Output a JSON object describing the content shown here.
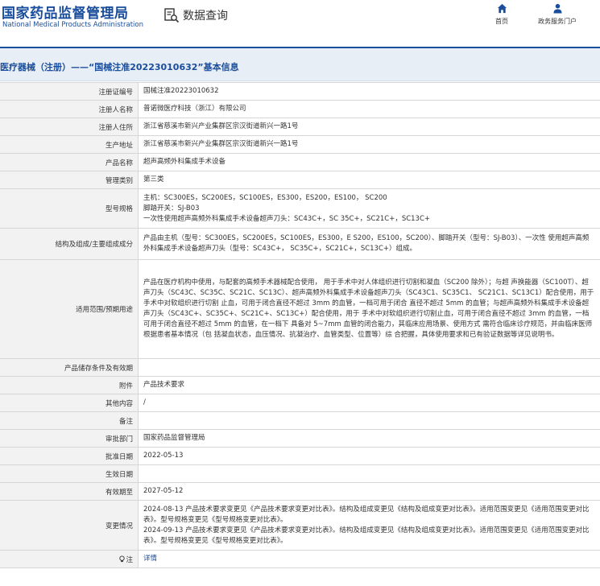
{
  "header": {
    "logo_cn": "国家药品监督管理局",
    "logo_en": "National Medical Products Administration",
    "query_label": "数据查询",
    "nav_home": "首页",
    "nav_gov": "政务服务门户"
  },
  "breadcrumb": "医疗器械（注册）——“国械注准20223010632”基本信息",
  "rows": [
    {
      "label": "注册证编号",
      "lines": [
        "国械注准20223010632"
      ]
    },
    {
      "label": "注册人名称",
      "lines": [
        "普诺微医疗科技（浙江）有限公司"
      ]
    },
    {
      "label": "注册人住所",
      "lines": [
        "浙江省慈溪市新兴产业集群区宗汉街道新兴一路1号"
      ]
    },
    {
      "label": "生产地址",
      "lines": [
        "浙江省慈溪市新兴产业集群区宗汉街道新兴一路1号"
      ]
    },
    {
      "label": "产品名称",
      "lines": [
        "超声高频外科集成手术设备"
      ]
    },
    {
      "label": "管理类别",
      "lines": [
        "第三类"
      ]
    },
    {
      "label": "型号规格",
      "lines": [
        "主机：SC300ES，SC200ES，SC100ES，ES300，ES200，ES100， SC200",
        "脚踏开关：SJ-B03",
        "一次性使用超声高频外科集成手术设备超声刀头：SC43C+，SC 35C+，SC21C+，SC13C+"
      ]
    },
    {
      "label": "结构及组成/主要组成成分",
      "lines": [
        "产品由主机（型号：SC300ES，SC200ES，SC100ES，ES300，E S200，ES100，SC200）、脚踏开关（型号：SJ-B03）、一次性 使用超声高频外科集成手术设备超声刀头（型号：SC43C+， SC35C+，SC21C+，SC13C+）组成。"
      ]
    },
    {
      "label": "适用范围/预期用途",
      "lines": [
        "产品在医疗机构中使用，与配套的高频手术器械配合使用， 用于手术中对人体组织进行切割和凝血（SC200 除外）；与超 声换能器（SC100T）、超声刀头（SC43C、SC35C、SC21C、SC13C）、超声高频外科集成手术设备超声刀头（SC43C1、SC35C1、 SC21C1、SC13C1）配合使用，用于手术中对软组织进行切割 止血，可用于闭合直径不超过 3mm 的血管，一档可用于闭合 直径不超过 5mm 的血管；与超声高频外科集成手术设备超 声刀头（SC43C+、SC35C+、SC21C+、SC13C+）配合使用，用于 手术中对软组织进行切割止血，可用于闭合直径不超过 3mm 的血管，一档可用于闭合直径不超过 5mm 的血管，在一档下 具备对 5~7mm 血管的闭合能力，其临床应用场景、使用方式 需符合临床诊疗规范，并由临床医师根据患者基本情况（包 括凝血状态，血压情况、抗凝治疗、血管类型、位置等）综 合把握，具体使用要求和已有验证数据等详见说明书。"
      ]
    },
    {
      "label": "产品储存条件及有效期",
      "lines": [
        ""
      ]
    },
    {
      "label": "附件",
      "lines": [
        "产品技术要求"
      ]
    },
    {
      "label": "其他内容",
      "lines": [
        "/"
      ]
    },
    {
      "label": "备注",
      "lines": [
        ""
      ]
    },
    {
      "label": "审批部门",
      "lines": [
        "国家药品监督管理局"
      ]
    },
    {
      "label": "批准日期",
      "lines": [
        "2022-05-13"
      ]
    },
    {
      "label": "生效日期",
      "lines": [
        ""
      ]
    },
    {
      "label": "有效期至",
      "lines": [
        "2027-05-12"
      ]
    },
    {
      "label": "变更情况",
      "lines": [
        "2024-08-13 产品技术要求变更见《产品技术要求变更对比表》。结构及组成变更见《结构及组成变更对比表》。适用范围变更见《适用范围变更对比表》。型号规格变更见《型号规格变更对比表》。",
        "2024-09-13 产品技术要求变更见《产品技术要求变更对比表》。结构及组成变更见《结构及组成变更对比表》。适用范围变更见《适用范围变更对比表》。型号规格变更见《型号规格变更对比表》。"
      ]
    },
    {
      "label": "注",
      "lines": [
        "详情"
      ]
    }
  ],
  "colors": {
    "brand": "#1a4d9b",
    "label_bg": "#f2f2f2",
    "crumb_bg": "#e8eef6"
  }
}
